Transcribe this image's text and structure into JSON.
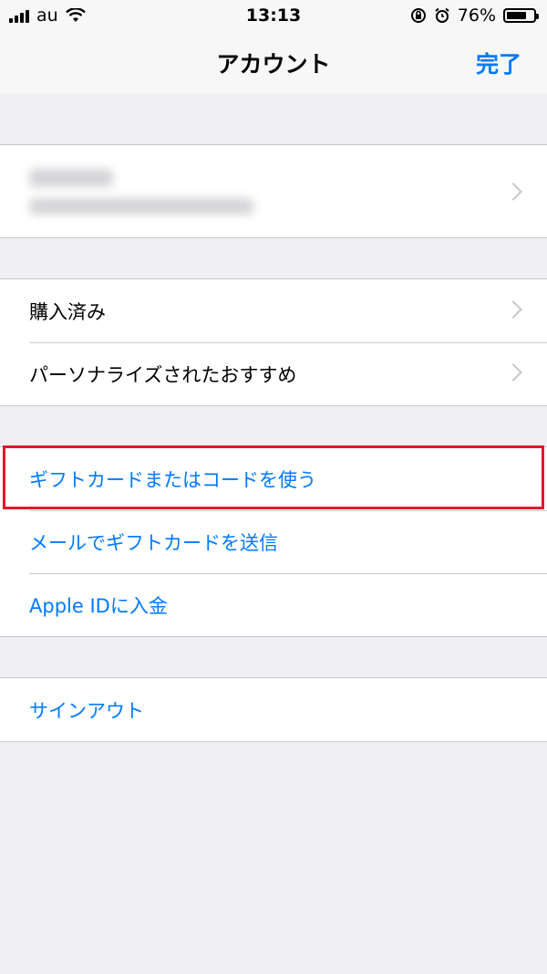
{
  "status_bar": {
    "carrier": "au",
    "time": "13:13",
    "battery_percent": "76%",
    "battery_level": 0.76,
    "icons": [
      "signal-icon",
      "wifi-icon",
      "orientation-lock-icon",
      "alarm-icon",
      "battery-icon"
    ]
  },
  "nav": {
    "title": "アカウント",
    "done_label": "完了"
  },
  "profile": {
    "name_redacted": true,
    "email_redacted": true
  },
  "purchases_section": {
    "items": [
      {
        "label": "購入済み"
      },
      {
        "label": "パーソナライズされたおすすめ"
      }
    ]
  },
  "gift_section": {
    "items": [
      {
        "label": "ギフトカードまたはコードを使う",
        "highlighted": true
      },
      {
        "label": "メールでギフトカードを送信"
      },
      {
        "label": "Apple IDに入金"
      }
    ]
  },
  "signout_section": {
    "label": "サインアウト"
  },
  "colors": {
    "accent": "#007aff",
    "background": "#efeff4",
    "highlight": "#e0182d"
  }
}
